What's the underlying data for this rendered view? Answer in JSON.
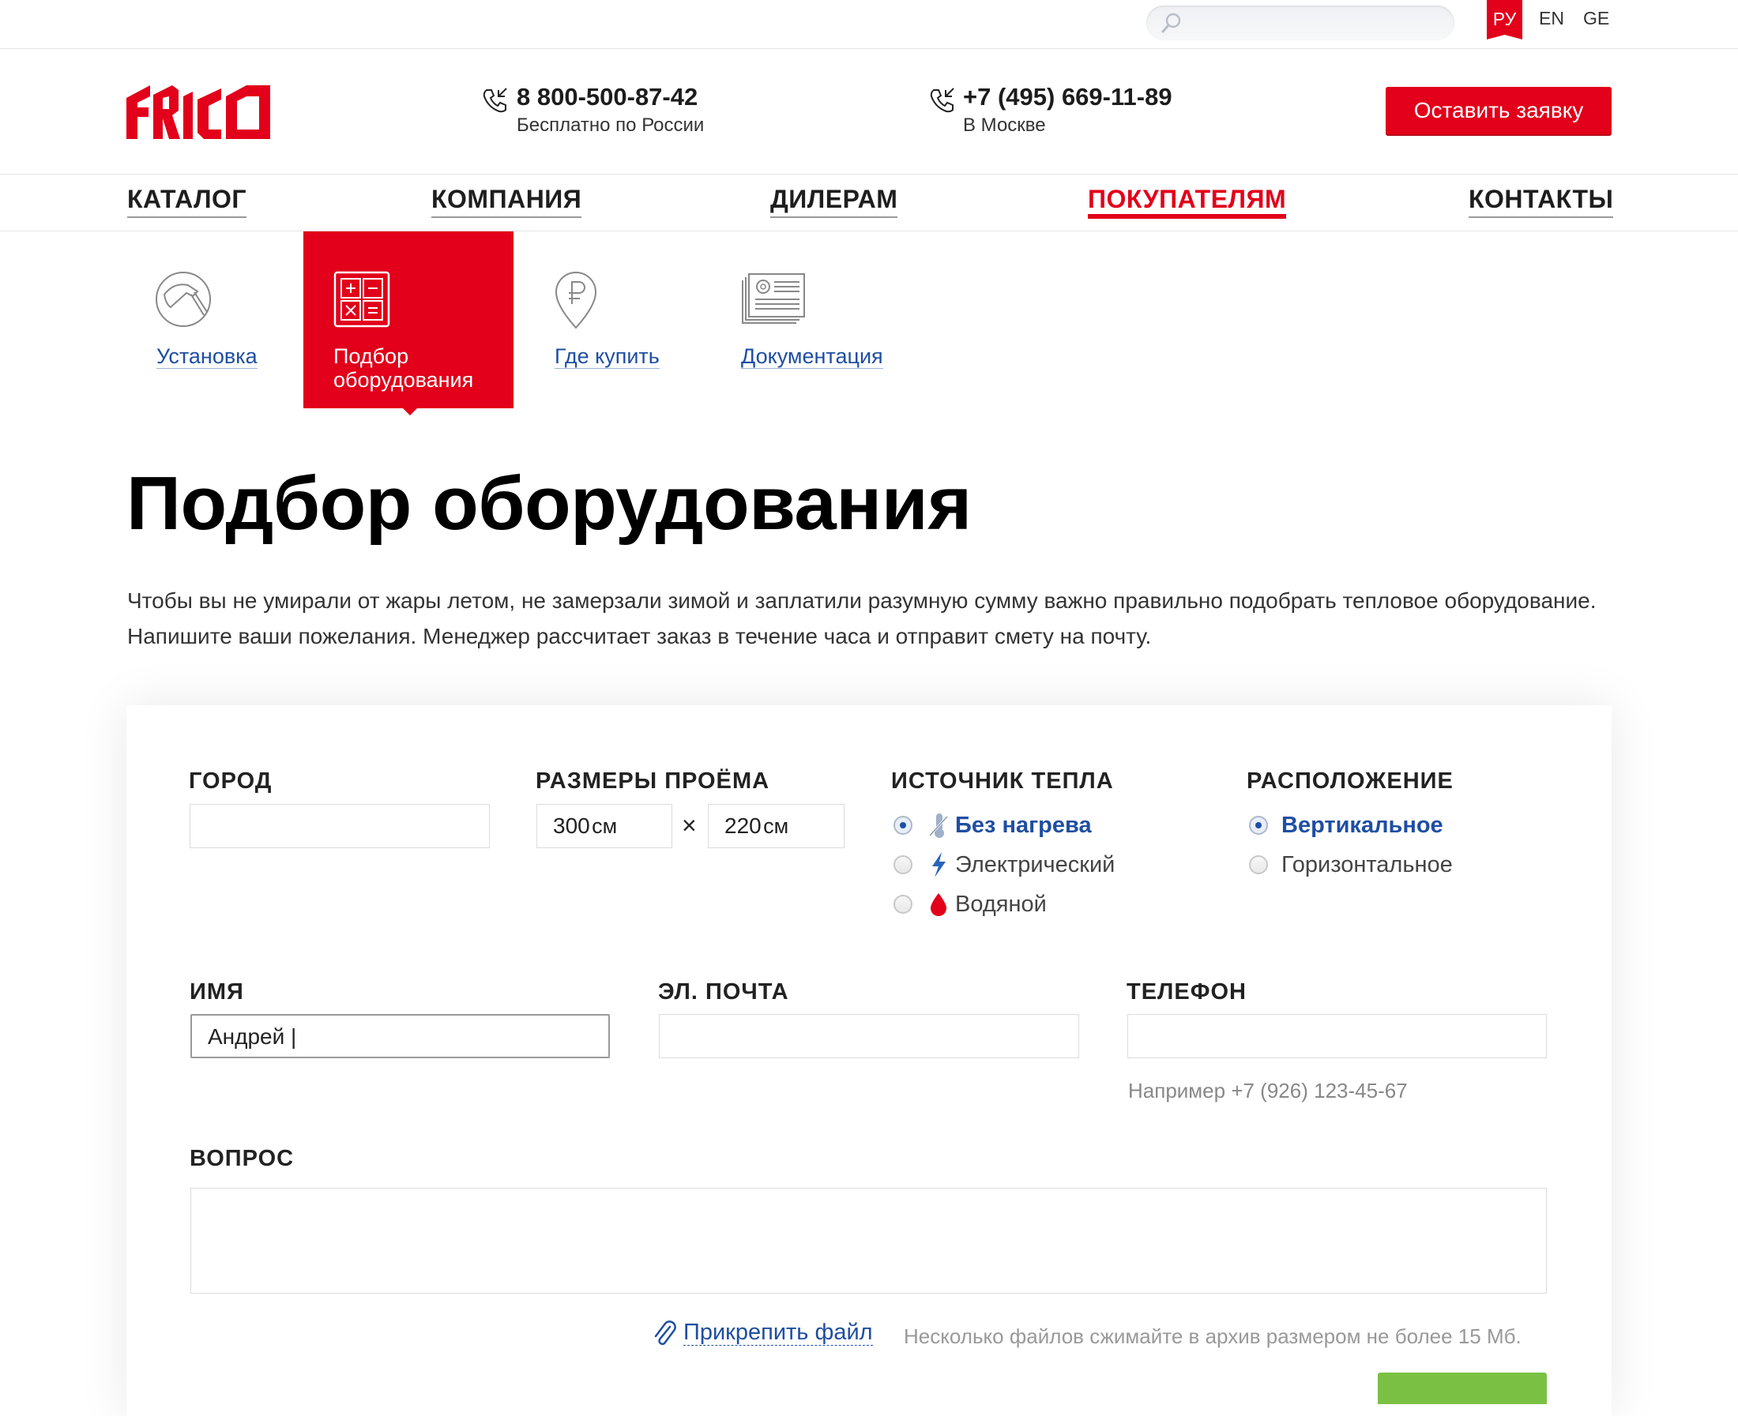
{
  "topbar": {
    "search_placeholder": "",
    "languages": [
      {
        "code": "РУ",
        "active": true
      },
      {
        "code": "EN",
        "active": false
      },
      {
        "code": "GE",
        "active": false
      }
    ]
  },
  "header": {
    "logo_text": "FRICO",
    "phones": [
      {
        "number": "8 800-500-87-42",
        "note": "Бесплатно по России"
      },
      {
        "number": "+7 (495) 669-11-89",
        "note": "В Москве"
      }
    ],
    "cta_label": "Оставить заявку"
  },
  "nav": {
    "items": [
      {
        "label": "Каталог",
        "active": false
      },
      {
        "label": "Компания",
        "active": false
      },
      {
        "label": "Дилерам",
        "active": false
      },
      {
        "label": "Покупателям",
        "active": true
      },
      {
        "label": "Контакты",
        "active": false
      }
    ]
  },
  "subnav": {
    "items": [
      {
        "label": "Установка",
        "icon": "hammer-icon",
        "active": false
      },
      {
        "label": "Подбор оборудования",
        "icon": "calculator-icon",
        "active": true
      },
      {
        "label": "Где купить",
        "icon": "ruble-pin-icon",
        "active": false
      },
      {
        "label": "Документация",
        "icon": "documents-icon",
        "active": false
      }
    ]
  },
  "page": {
    "title": "Подбор оборудования",
    "intro": "Чтобы вы не умирали от жары летом, не замерзали зимой и заплатили разумную сумму важно правильно подобрать тепловое оборудование. Напишите ваши пожелания. Менеджер рассчитает заказ в течение часа и отправит смету на почту."
  },
  "form": {
    "city": {
      "label": "Город",
      "value": ""
    },
    "opening": {
      "label": "Размеры проёма",
      "width": "300",
      "height": "220",
      "unit": "см",
      "separator": "×"
    },
    "heat_source": {
      "label": "Источник тепла",
      "options": [
        {
          "label": "Без нагрева",
          "icon": "no-heat-icon",
          "selected": true
        },
        {
          "label": "Электрический",
          "icon": "lightning-icon",
          "selected": false
        },
        {
          "label": "Водяной",
          "icon": "water-drop-icon",
          "selected": false
        }
      ]
    },
    "placement": {
      "label": "Расположение",
      "options": [
        {
          "label": "Вертикальное",
          "selected": true
        },
        {
          "label": "Горизонтальное",
          "selected": false
        }
      ]
    },
    "name": {
      "label": "Имя",
      "value": "Андрей |"
    },
    "email": {
      "label": "Эл. почта",
      "value": ""
    },
    "phone": {
      "label": "Телефон",
      "value": "",
      "hint": "Например +7 (926) 123-45-67"
    },
    "question": {
      "label": "Вопрос",
      "value": ""
    },
    "attach": {
      "label": "Прикрепить файл",
      "note": "Несколько файлов сжимайте в архив размером не более 15 Мб."
    }
  },
  "colors": {
    "brand": "#e2001a",
    "link": "#1f4ea3",
    "submit": "#7ac143"
  }
}
